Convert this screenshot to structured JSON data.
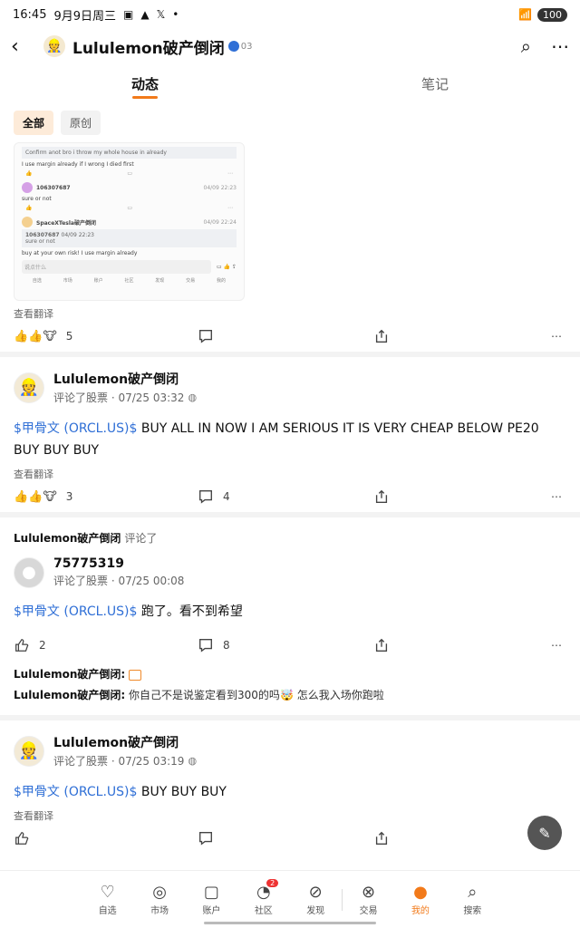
{
  "status": {
    "time": "16:45",
    "date": "9月9日周三",
    "battery": "100"
  },
  "header": {
    "title": "Lululemon破产倒闭",
    "badge_num": "03"
  },
  "tabs": [
    {
      "label": "动态"
    },
    {
      "label": "笔记"
    }
  ],
  "chips": [
    {
      "label": "全部"
    },
    {
      "label": "原创"
    }
  ],
  "shot": {
    "quote1": "Confirm anot bro i throw my whole house in already",
    "line1": "I use margin already if I wrong I died first",
    "c1_user": "106307687",
    "c1_time": "04/09 22:23",
    "c1_text": "sure or not",
    "c2_user": "SpaceXTesla破产倒闭",
    "c2_time": "04/09 22:24",
    "c2_quote_user": "106307687",
    "c2_quote_time": "04/09 22:23",
    "c2_quote_text": "sure or not",
    "c2_text": "buy at your own risk! I use margin already",
    "input_placeholder": "说点什么",
    "nav": [
      "自选",
      "市场",
      "账户",
      "社区",
      "发现",
      "交易",
      "我的"
    ]
  },
  "post0": {
    "translate": "查看翻译",
    "likes": "5"
  },
  "post1": {
    "user": "Lululemon破产倒闭",
    "meta": "评论了股票 · 07/25 03:32",
    "ticker": "$甲骨文 (ORCL.US)$",
    "text": " BUY ALL IN NOW I AM SERIOUS IT IS VERY CHEAP BELOW PE20 BUY BUY BUY",
    "translate": "查看翻译",
    "likes": "3",
    "comments": "4"
  },
  "post2": {
    "head_user": "Lululemon破产倒闭",
    "head_verb": "评论了",
    "user": "75775319",
    "meta": "评论了股票 · 07/25 00:08",
    "ticker": "$甲骨文 (ORCL.US)$",
    "text": " 跑了。看不到希望",
    "likes": "2",
    "comments": "8",
    "reply1_user": "Lululemon破产倒闭:",
    "reply2_user": "Lululemon破产倒闭:",
    "reply2_text": " 你自己不是说鉴定看到300的吗",
    "reply2_text2": " 怎么我入场你跑啦"
  },
  "post3": {
    "user": "Lululemon破产倒闭",
    "meta": "评论了股票 · 07/25 03:19",
    "ticker": "$甲骨文 (ORCL.US)$",
    "text": " BUY BUY BUY",
    "translate": "查看翻译"
  },
  "bottomnav": [
    {
      "label": "自选",
      "icon": "heart-icon"
    },
    {
      "label": "市场",
      "icon": "planet-icon"
    },
    {
      "label": "账户",
      "icon": "wallet-icon"
    },
    {
      "label": "社区",
      "icon": "community-icon",
      "badge": "2"
    },
    {
      "label": "发现",
      "icon": "compass-icon"
    },
    {
      "label": "交易",
      "icon": "trade-icon"
    },
    {
      "label": "我的",
      "icon": "profile-icon"
    },
    {
      "label": "搜索",
      "icon": "search-icon"
    }
  ],
  "colors": {
    "accent": "#f27a1a",
    "ticker": "#2f6fd6"
  }
}
